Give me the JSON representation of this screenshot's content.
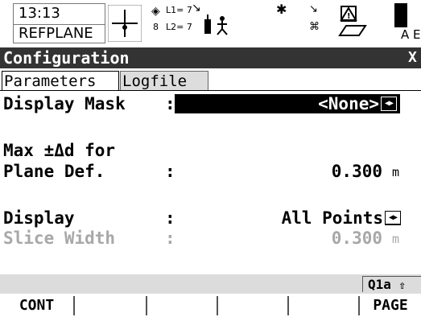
{
  "status": {
    "time": "13:13",
    "job": "REFPLANE",
    "l1_label": "L1= 7",
    "l2_label": "L2= 7",
    "sat_count": "8",
    "status_right": "A E"
  },
  "window": {
    "title": "Configuration",
    "close_glyph": "X"
  },
  "tabs": [
    {
      "label": "Parameters",
      "active": true
    },
    {
      "label": "Logfile",
      "active": false
    }
  ],
  "form": {
    "display_mask": {
      "label": "Display Mask",
      "colon": ":",
      "value": "<None>"
    },
    "max_d": {
      "label_line1": "Max ±Δd for",
      "label_line2": "Plane Def.",
      "colon": ":",
      "value": "0.300",
      "unit": "m"
    },
    "display": {
      "label": "Display",
      "colon": ":",
      "value": "All Points"
    },
    "slice_width": {
      "label": "Slice Width",
      "colon": ":",
      "value": "0.300",
      "unit": "m",
      "enabled": false
    }
  },
  "status_strip": {
    "indicator": "Q1a"
  },
  "softkeys": [
    "CONT",
    "",
    "",
    "",
    "",
    "",
    "PAGE"
  ]
}
